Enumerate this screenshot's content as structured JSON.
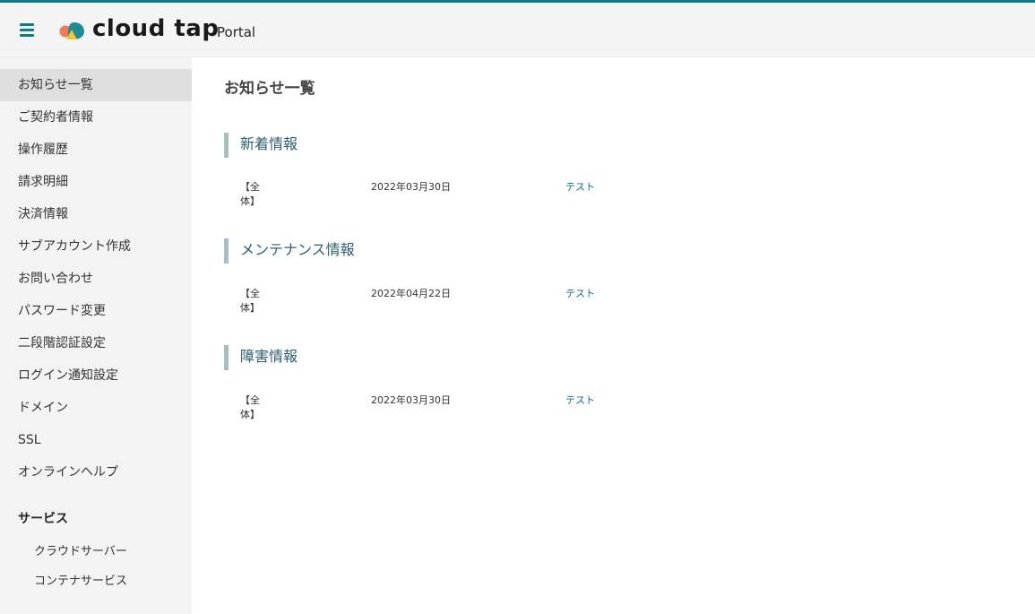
{
  "colors": {
    "accent": "#0f7a86",
    "link": "#0f6e7c",
    "section_bar": "#a4bfc4",
    "sidebar_bg": "#f3f3f3"
  },
  "header": {
    "brand": "cloud tap",
    "sub": "Portal",
    "menu_icon": "hamburger-icon",
    "logo_icon": "cloud-tap-logo"
  },
  "sidebar": {
    "items": [
      {
        "label": "お知らせ一覧",
        "active": true
      },
      {
        "label": "ご契約者情報"
      },
      {
        "label": "操作履歴"
      },
      {
        "label": "請求明細"
      },
      {
        "label": "決済情報"
      },
      {
        "label": "サブアカウント作成"
      },
      {
        "label": "お問い合わせ"
      },
      {
        "label": "パスワード変更"
      },
      {
        "label": "二段階認証設定"
      },
      {
        "label": "ログイン通知設定"
      },
      {
        "label": "ドメイン"
      },
      {
        "label": "SSL"
      },
      {
        "label": "オンラインヘルプ"
      }
    ],
    "services_heading": "サービス",
    "services": [
      {
        "label": "クラウドサーバー"
      },
      {
        "label": "コンテナサービス"
      }
    ]
  },
  "main": {
    "title": "お知らせ一覧",
    "sections": [
      {
        "heading": "新着情報",
        "rows": [
          {
            "scope": "【全体】",
            "date": "2022年03月30日",
            "link": "テスト"
          }
        ]
      },
      {
        "heading": "メンテナンス情報",
        "rows": [
          {
            "scope": "【全体】",
            "date": "2022年04月22日",
            "link": "テスト"
          }
        ]
      },
      {
        "heading": "障害情報",
        "rows": [
          {
            "scope": "【全体】",
            "date": "2022年03月30日",
            "link": "テスト"
          }
        ]
      }
    ]
  }
}
